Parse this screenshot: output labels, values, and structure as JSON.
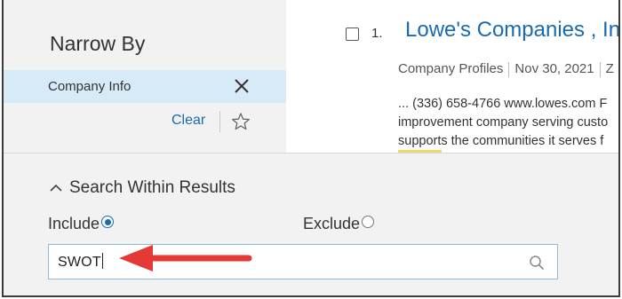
{
  "sidebar": {
    "title": "Narrow By",
    "active_filter": "Company Info",
    "clear_label": "Clear"
  },
  "results": {
    "items": [
      {
        "number": "1.",
        "title": "Lowe's Companies , Inc",
        "meta": [
          "Company Profiles",
          "Nov 30, 2021",
          "Z"
        ],
        "snippet": [
          "... (336) 658-4766 www.lowes.com F",
          "improvement company serving custo",
          "supports the communities it serves f"
        ]
      }
    ]
  },
  "search_within": {
    "heading": "Search Within Results",
    "include_label": "Include",
    "exclude_label": "Exclude",
    "include_selected": true,
    "query": "SWOT"
  },
  "colors": {
    "accent": "#1a6ab2",
    "filter_highlight": "#d6eaf7",
    "arrow": "#e53935"
  },
  "icons": [
    "close-icon",
    "star-icon",
    "chevron-up-icon",
    "search-icon",
    "arrow-annotation"
  ]
}
